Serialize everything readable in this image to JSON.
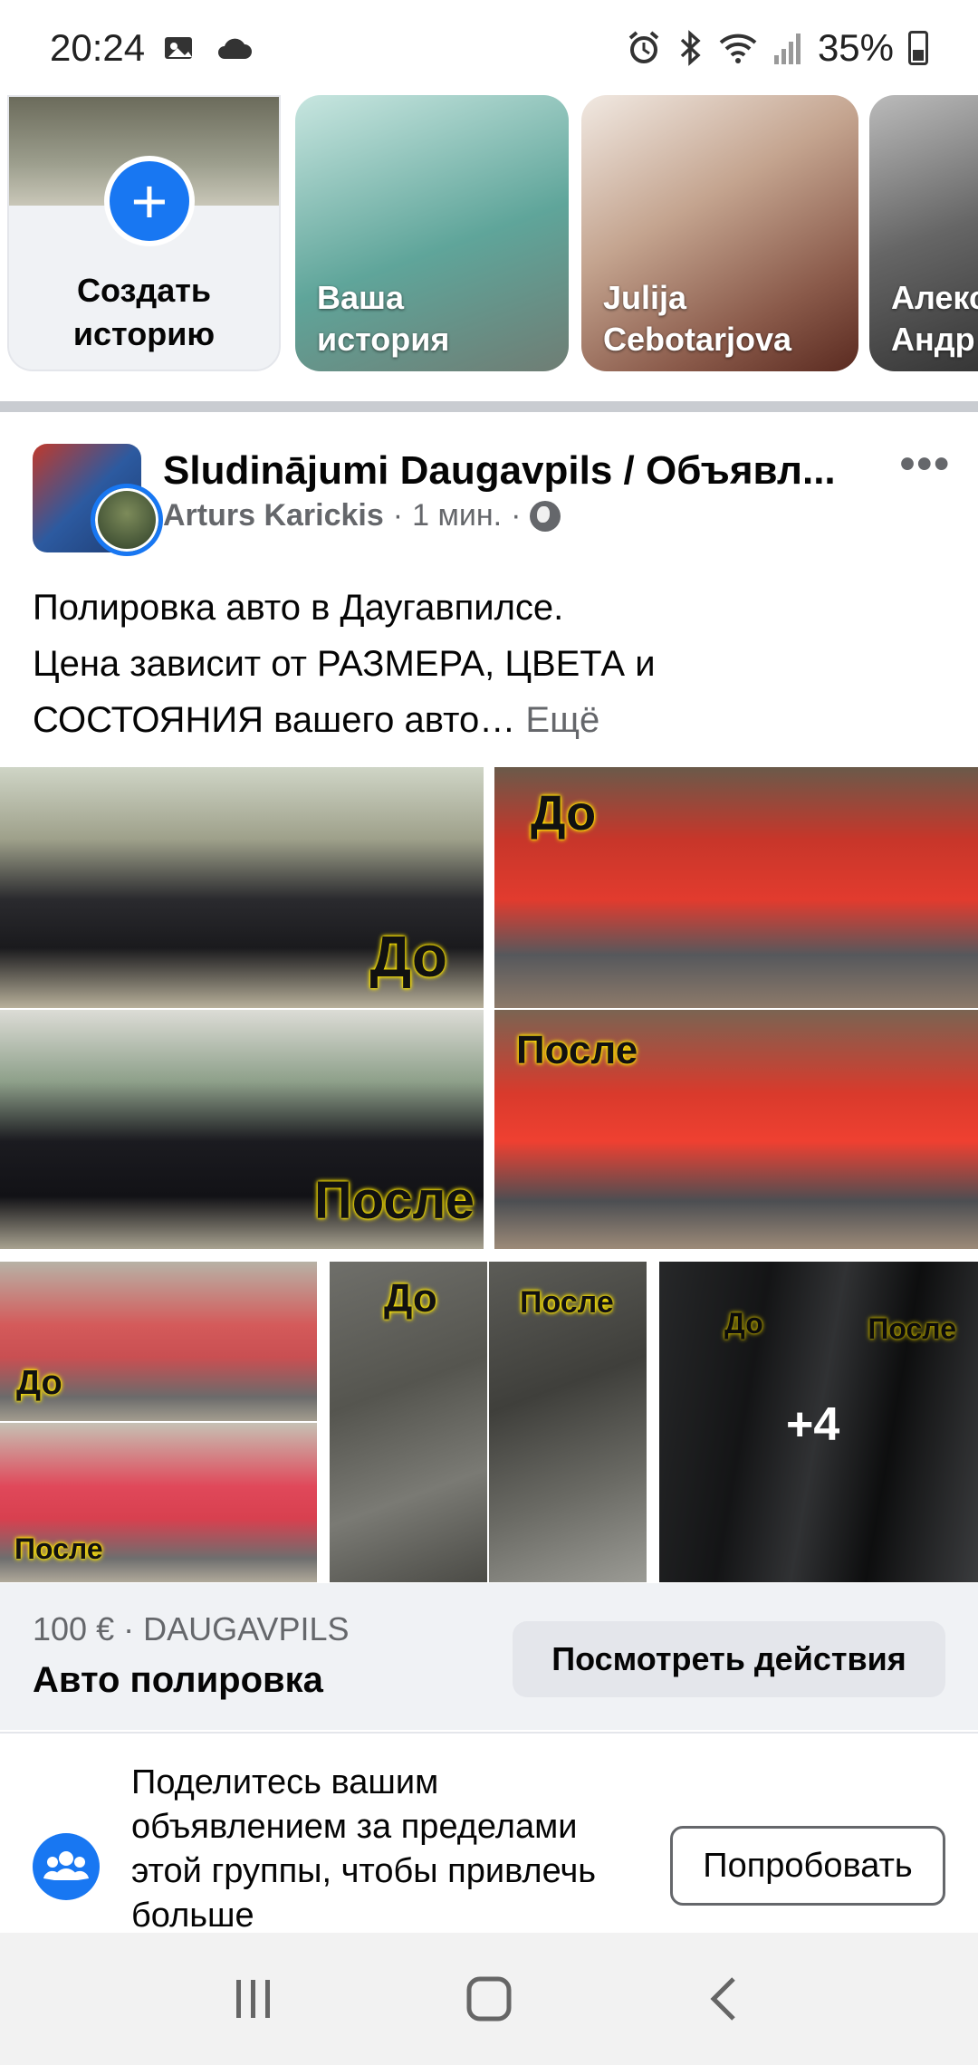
{
  "status_bar": {
    "time": "20:24",
    "battery": "35%"
  },
  "stories": {
    "create": {
      "label": "Создать\nисторию"
    },
    "items": [
      {
        "name": "Ваша\nистория"
      },
      {
        "name": "Julija\nCebotarjova"
      },
      {
        "name": "Алекс\nАндр"
      }
    ]
  },
  "post": {
    "group_name": "Sludinājumi Daugavpils / Объявл...",
    "author": "Arturs Karickis",
    "time": "1 мин.",
    "text_line1": "Полировка авто в Даугавпилсе.",
    "text_line2": "Цена зависит от РАЗМЕРА, ЦВЕТА и",
    "text_line3": "СОСТОЯНИЯ вашего авто…",
    "more_label": "Ещё"
  },
  "gallery": {
    "before_label": "До",
    "after_label": "После",
    "more_count": "+4"
  },
  "listing": {
    "price_location": "100 € · DAUGAVPILS",
    "title": "Авто полировка",
    "actions_label": "Посмотреть действия"
  },
  "share_banner": {
    "text": "Поделитесь вашим объявлением за пределами этой группы, чтобы привлечь больше",
    "button_label": "Попробовать"
  },
  "colors": {
    "accent": "#1877f2",
    "secondary_text": "#65676b",
    "highlight_label": "#ffe600"
  },
  "icons": [
    "alarm-icon",
    "bluetooth-icon",
    "wifi-icon",
    "signal-icon",
    "battery-icon",
    "plus-icon",
    "globe-icon",
    "more-icon",
    "group-icon",
    "recents-icon",
    "home-icon",
    "back-icon"
  ]
}
